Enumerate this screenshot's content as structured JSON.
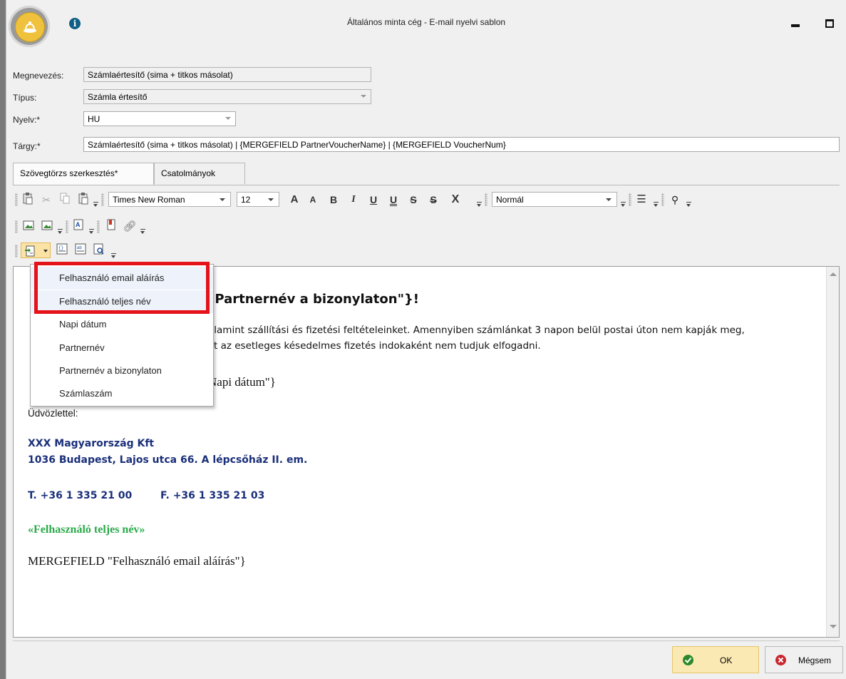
{
  "window": {
    "title": "Általános minta cég - E-mail nyelvi sablon"
  },
  "form": {
    "name": {
      "label": "Megnevezés:",
      "value": "Számlaértesítő (sima + titkos másolat)"
    },
    "type": {
      "label": "Típus:",
      "value": "Számla értesítő"
    },
    "language": {
      "label": "Nyelv:*",
      "value": "HU"
    },
    "subject": {
      "label": "Tárgy:*",
      "value": "Számlaértesítő (sima + titkos másolat) |  {MERGEFIELD PartnerVoucherName} | {MERGEFIELD VoucherNum}"
    }
  },
  "tabs": [
    {
      "label": "Szövegtörzs szerkesztés*",
      "active": true
    },
    {
      "label": "Csatolmányok",
      "active": false
    }
  ],
  "toolbar": {
    "font_family": "Times New Roman",
    "font_size": "12",
    "style": "Normál",
    "buttons": {
      "grow": "A",
      "shrink": "A",
      "bold": "B",
      "italic": "I",
      "underline": "U",
      "double_underline": "U",
      "strike": "S",
      "double_strike": "S",
      "superscript": "X"
    }
  },
  "editor": {
    "heading_fragment": "\"Partnernév a bizonylaton\"}!",
    "body_line1_fragment": "alamint szállítási és fizetési feltételeinket.  Amennyiben számlánkat 3 napon belül postai úton nem kapják meg,",
    "body_line2_fragment": "yt az esetleges késedelmes fizetés indokaként nem tudjuk elfogadni.",
    "date_fragment": "Napi dátum\"}",
    "greeting": "Üdvözlettel:",
    "company_name": "XXX Magyarország Kft",
    "company_address": "1036 Budapest, Lajos utca 66. A lépcsőház II. em.",
    "phone": "T. +36 1 335 21 00",
    "fax": "F. +36 1 335 21 03",
    "user_fullname_field": "«Felhasználó teljes név»",
    "signature_field": "MERGEFIELD \"Felhasználó email aláírás\"}"
  },
  "merge_menu": {
    "items": [
      "Felhasználó email aláírás",
      "Felhasználó teljes név",
      "Napi dátum",
      "Partnernév",
      "Partnernév a bizonylaton",
      "Számlaszám"
    ],
    "highlight_color": "#e41219"
  },
  "footer": {
    "ok": "OK",
    "cancel": "Mégsem"
  },
  "colors": {
    "ok_bg": "#fbe9b4",
    "company_blue": "#1a2f7a",
    "merge_green": "#2aaa4a"
  }
}
